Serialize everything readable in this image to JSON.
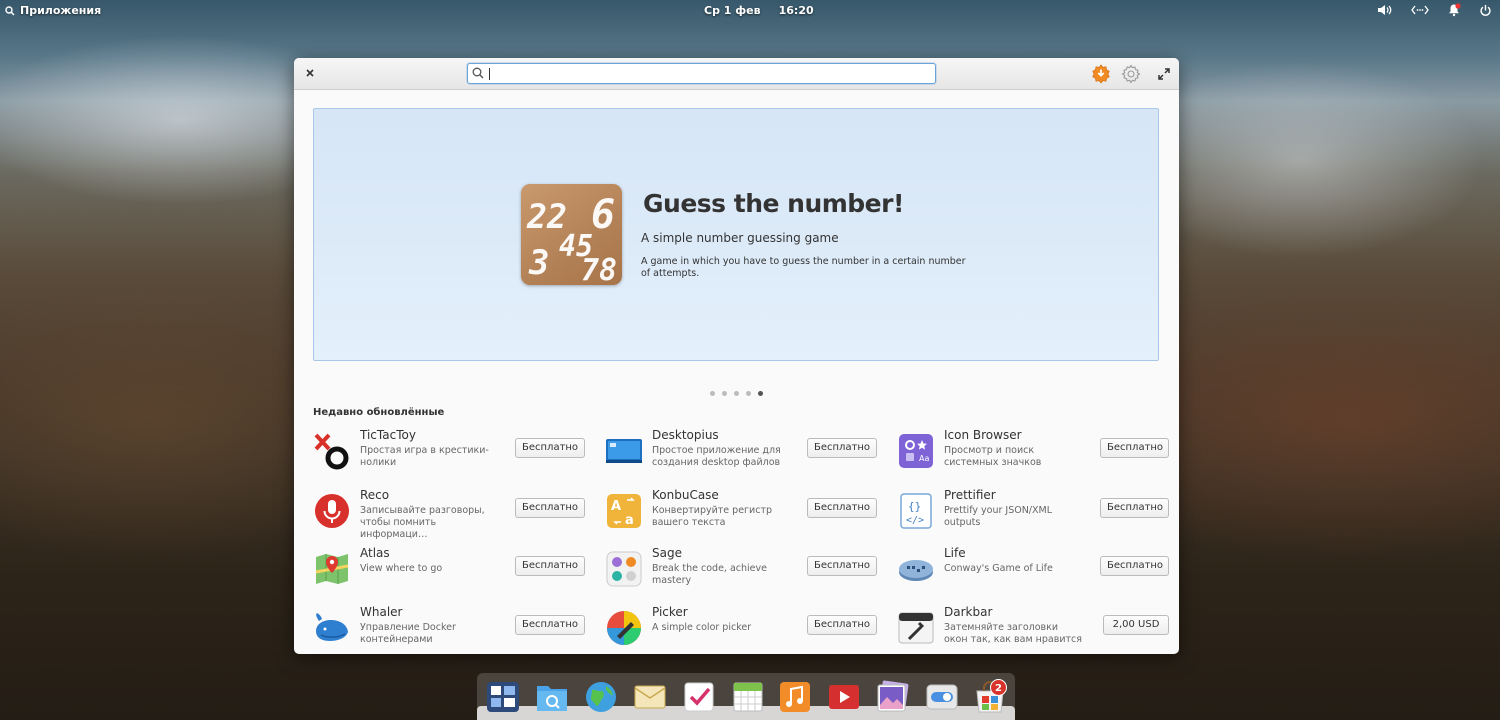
{
  "top_panel": {
    "applications_label": "Приложения",
    "date": "Ср 1 фев",
    "time": "16:20"
  },
  "window": {
    "search": {
      "value": "",
      "placeholder": ""
    },
    "banner": {
      "title": "Guess the number!",
      "summary": "A simple number guessing game",
      "description": "A game in which you have to guess the number in a certain number of attempts.",
      "icon_digits": [
        "22",
        "6",
        "45",
        "3",
        "78"
      ],
      "carousel_total": 5,
      "carousel_active": 5
    },
    "section_title": "Недавно обновлённые",
    "apps": [
      {
        "name": "TicTacToy",
        "desc": "Простая игра в крестики-нолики",
        "price": "Бесплатно",
        "icon": "tictactoy-icon"
      },
      {
        "name": "Desktopius",
        "desc": "Простое приложение для создания desktop файлов",
        "price": "Бесплатно",
        "icon": "desktopius-icon"
      },
      {
        "name": "Icon Browser",
        "desc": "Просмотр и поиск системных значков",
        "price": "Бесплатно",
        "icon": "icon-browser-icon"
      },
      {
        "name": "Reco",
        "desc": "Записывайте разговоры, чтобы помнить информаци…",
        "price": "Бесплатно",
        "icon": "microphone-icon"
      },
      {
        "name": "KonbuCase",
        "desc": "Конвертируйте регистр вашего текста",
        "price": "Бесплатно",
        "icon": "konbucase-icon"
      },
      {
        "name": "Prettifier",
        "desc": "Prettify your JSON/XML outputs",
        "price": "Бесплатно",
        "icon": "prettifier-icon"
      },
      {
        "name": "Atlas",
        "desc": "View where to go",
        "price": "Бесплатно",
        "icon": "map-icon"
      },
      {
        "name": "Sage",
        "desc": "Break the code, achieve mastery",
        "price": "Бесплатно",
        "icon": "sage-icon"
      },
      {
        "name": "Life",
        "desc": "Conway's Game of Life",
        "price": "Бесплатно",
        "icon": "life-icon"
      },
      {
        "name": "Whaler",
        "desc": "Управление Docker контейнерами",
        "price": "Бесплатно",
        "icon": "whale-icon"
      },
      {
        "name": "Picker",
        "desc": "A simple color picker",
        "price": "Бесплатно",
        "icon": "color-picker-icon"
      },
      {
        "name": "Darkbar",
        "desc": "Затемняйте заголовки окон так, как вам нравится",
        "price": "2,00 USD",
        "icon": "darkbar-icon"
      }
    ]
  },
  "dock": {
    "items": [
      "multitasking-view-icon",
      "files-icon",
      "web-browser-icon",
      "mail-icon",
      "tasks-icon",
      "calendar-icon",
      "music-icon",
      "videos-icon",
      "photos-icon",
      "system-settings-icon",
      "appcenter-icon"
    ],
    "appcenter_badge": "2"
  },
  "colors": {
    "accent": "#6aa3d8",
    "banner_bg": "#dceaf8",
    "badge": "#d9342b"
  }
}
